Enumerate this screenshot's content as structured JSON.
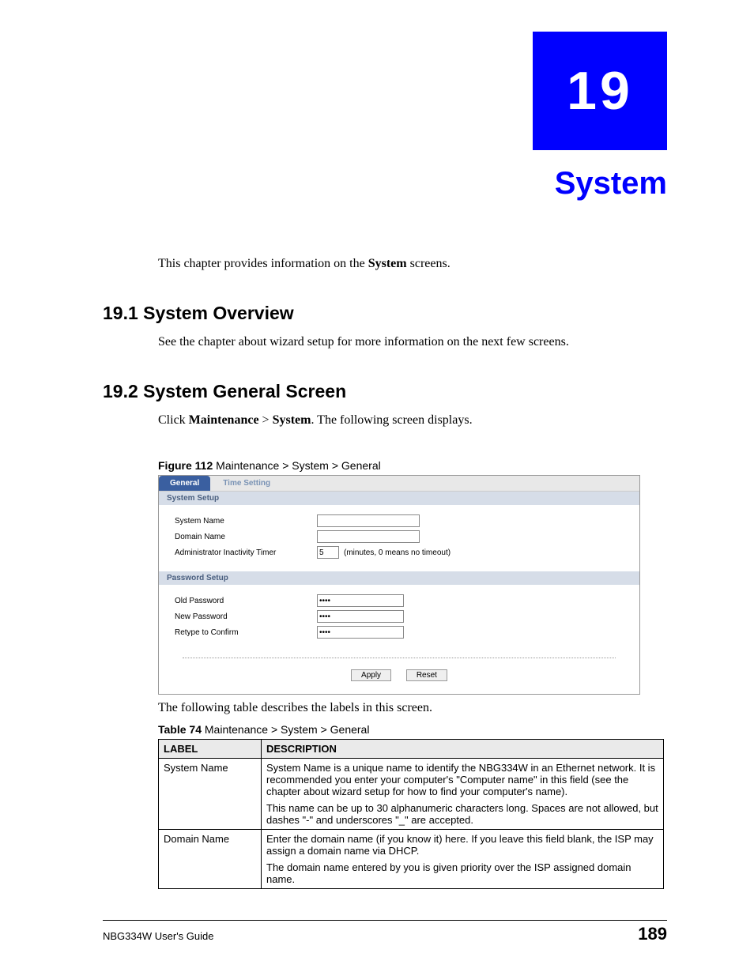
{
  "chapter": {
    "number": "19",
    "title": "System"
  },
  "intro": {
    "prefix": "This chapter provides information on the ",
    "bold": "System",
    "suffix": " screens."
  },
  "section191": {
    "heading": "19.1  System Overview",
    "body": "See the chapter about wizard setup for more information on the next few screens."
  },
  "section192": {
    "heading": "19.2  System General Screen",
    "body_prefix": "Click ",
    "body_b1": "Maintenance",
    "body_gt": " > ",
    "body_b2": "System",
    "body_suffix": ". The following screen displays."
  },
  "figure": {
    "label": "Figure 112",
    "caption": "   Maintenance > System > General"
  },
  "ui": {
    "tabs": {
      "general": "General",
      "time": "Time Setting"
    },
    "system_setup": {
      "heading": "System Setup",
      "system_name": "System Name",
      "domain_name": "Domain Name",
      "admin_timer": "Administrator Inactivity Timer",
      "timer_value": "5",
      "timer_hint": "(minutes, 0 means no timeout)"
    },
    "password_setup": {
      "heading": "Password Setup",
      "old_pw": "Old Password",
      "new_pw": "New Password",
      "retype": "Retype to Confirm",
      "mask": "••••"
    },
    "buttons": {
      "apply": "Apply",
      "reset": "Reset"
    }
  },
  "post_figure": "The following table describes the labels in this screen.",
  "table": {
    "label": "Table 74",
    "caption": "   Maintenance > System > General",
    "head_label": "LABEL",
    "head_desc": "DESCRIPTION",
    "row1": {
      "label": "System Name",
      "p1": "System Name is a unique name to identify the NBG334W in an Ethernet network. It is recommended you enter your computer's \"Computer name\" in this field (see the chapter about wizard setup for how to find your computer's name).",
      "p2": "This name can be up to 30 alphanumeric characters long. Spaces are not allowed, but dashes \"-\" and underscores \"_\" are accepted."
    },
    "row2": {
      "label": "Domain Name",
      "p1": "Enter the domain name (if you know it) here. If you leave this field blank, the ISP may assign a domain name via DHCP.",
      "p2": "The domain name entered by you is given priority over the ISP assigned domain name."
    }
  },
  "footer": {
    "guide": "NBG334W User's Guide",
    "page": "189"
  }
}
